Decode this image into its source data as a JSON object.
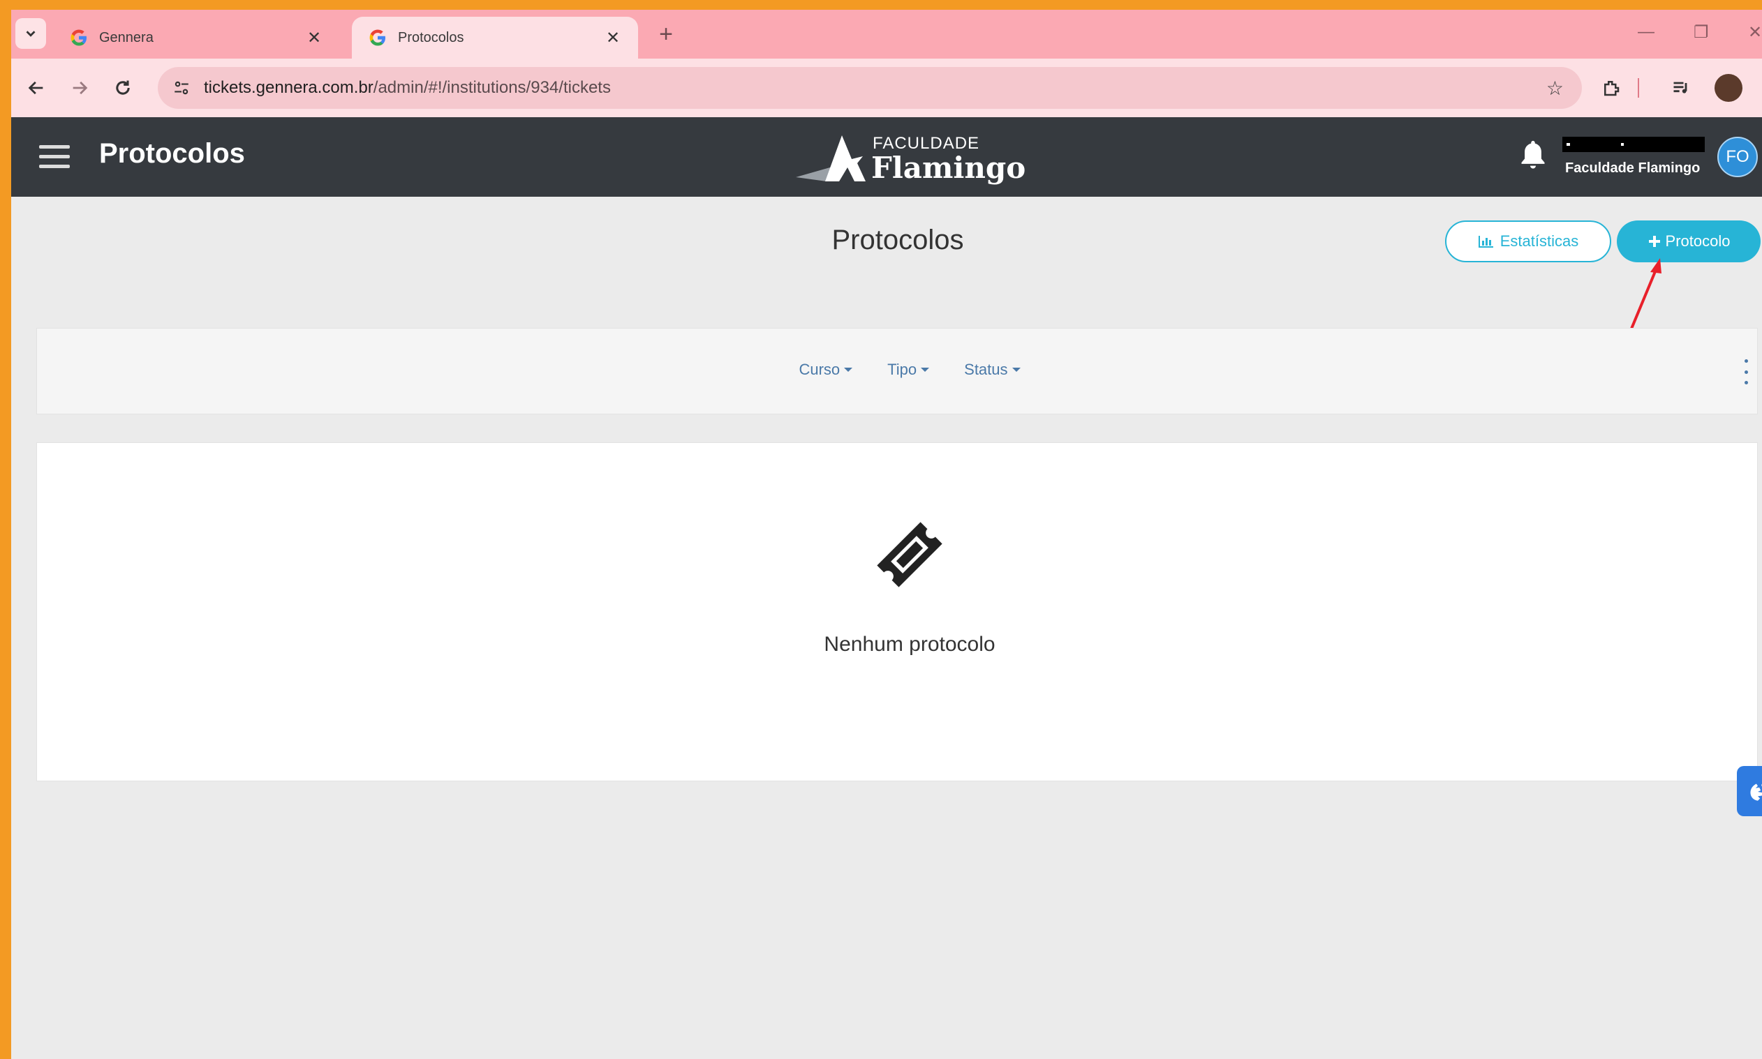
{
  "browser": {
    "tabs": [
      {
        "title": "Gennera",
        "active": false
      },
      {
        "title": "Protocolos",
        "active": true
      }
    ],
    "url_host": "tickets.gennera.com.br",
    "url_path": "/admin/#!/institutions/934/tickets"
  },
  "header": {
    "title": "Protocolos",
    "brand_small": "FACULDADE",
    "brand_big": "Flamingo",
    "user_name": "Faculdade Flamingo",
    "avatar_initials": "FO"
  },
  "page": {
    "title": "Protocolos",
    "stats_button": "Estatísticas",
    "new_button": "Protocolo",
    "filters": [
      "Curso",
      "Tipo",
      "Status"
    ],
    "empty_message": "Nenhum protocolo"
  },
  "colors": {
    "accent": "#27b4d6",
    "header_bg": "#363a3f",
    "tabstrip_bg": "#fba9b3",
    "frame": "#f39a23",
    "annotation_arrow": "#e8202a"
  }
}
